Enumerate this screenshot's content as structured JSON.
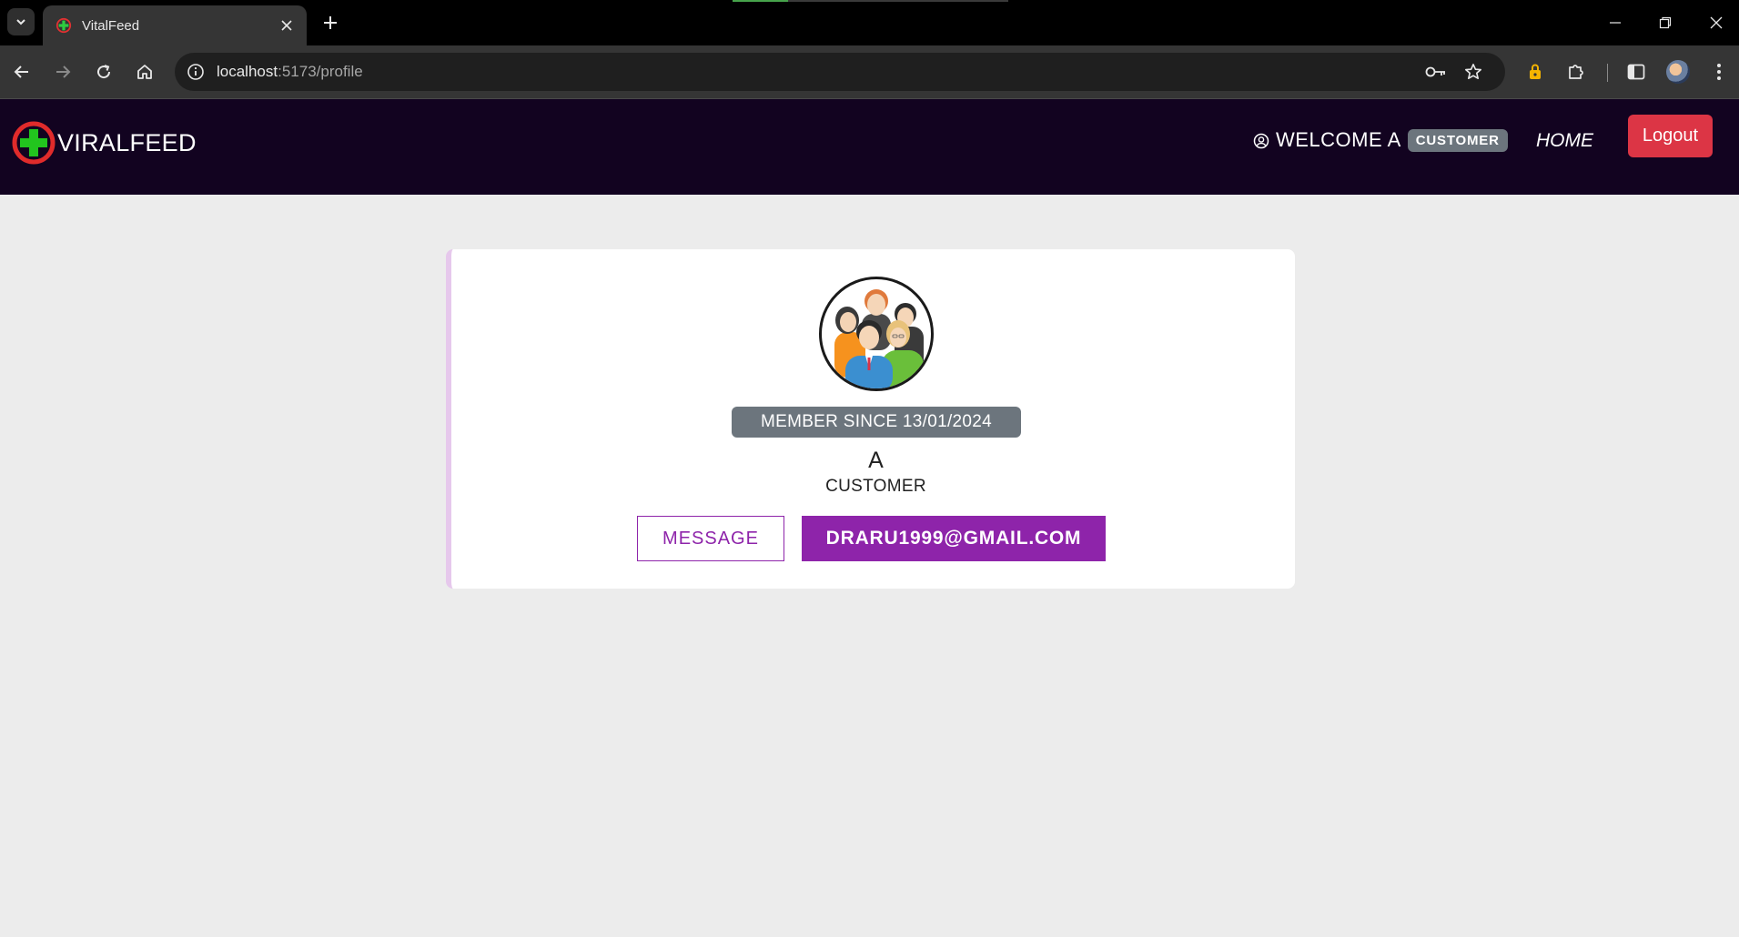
{
  "browser": {
    "tab_title": "VitalFeed",
    "url_host": "localhost",
    "url_rest": ":5173/profile",
    "loading_progress": 0.2
  },
  "navbar": {
    "brand": "VIRALFEED",
    "welcome_text": "WELCOME A",
    "role_badge": "CUSTOMER",
    "home_link": "HOME",
    "logout_label": "Logout"
  },
  "profile": {
    "member_since": "MEMBER SINCE 13/01/2024",
    "name": "A",
    "role": "CUSTOMER",
    "message_label": "MESSAGE",
    "email": "DRARU1999@GMAIL.COM"
  },
  "colors": {
    "navbar_bg": "#120320",
    "accent_purple": "#8e24aa",
    "logout_red": "#dc3545",
    "badge_gray": "#6c757d",
    "page_bg": "#ececec"
  },
  "icons": {
    "brand_logo": "medical-cross-logo-icon",
    "welcome": "user-circle-icon",
    "avatar": "group-people-avatar"
  }
}
